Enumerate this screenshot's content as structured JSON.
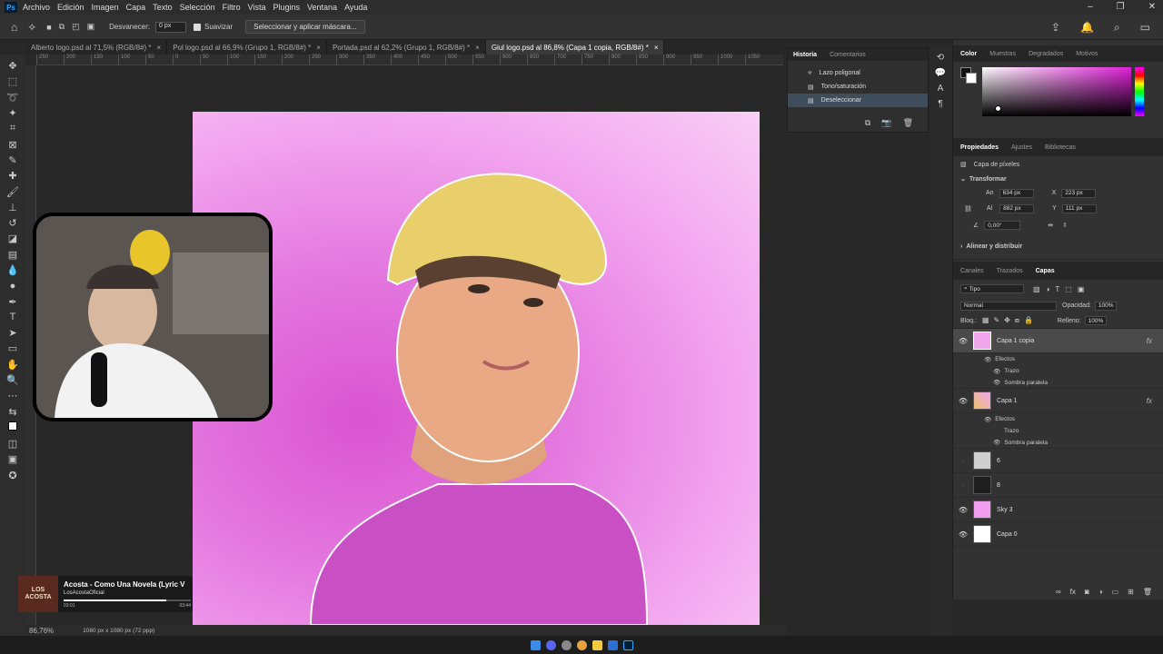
{
  "menu": {
    "items": [
      "Archivo",
      "Edición",
      "Imagen",
      "Capa",
      "Texto",
      "Selección",
      "Filtro",
      "Vista",
      "Plugins",
      "Ventana",
      "Ayuda"
    ]
  },
  "options": {
    "feather_label": "Desvanecer:",
    "feather_value": "0 px",
    "smooth_label": "Suavizar",
    "mask_button": "Seleccionar y aplicar máscara..."
  },
  "doc_tabs": [
    {
      "label": "Alberto logo.psd al 71,5% (RGB/8#) *",
      "active": false
    },
    {
      "label": "Pol logo.psd al 66,9% (Grupo 1, RGB/8#) *",
      "active": false
    },
    {
      "label": "Portada.psd al 62,2% (Grupo 1, RGB/8#) *",
      "active": false
    },
    {
      "label": "Giul logo.psd al 86,8% (Capa 1 copia, RGB/8#) *",
      "active": true
    }
  ],
  "ruler_ticks": [
    "250",
    "200",
    "150",
    "100",
    "50",
    "0",
    "50",
    "100",
    "150",
    "200",
    "250",
    "300",
    "350",
    "400",
    "450",
    "500",
    "550",
    "600",
    "650",
    "700",
    "750",
    "800",
    "850",
    "900",
    "950",
    "1000",
    "1050"
  ],
  "status": {
    "zoom": "86,76%",
    "doc_info": "1080 px x 1080 px (72 ppp)"
  },
  "history": {
    "tabs": [
      "Historia",
      "Comentarios"
    ],
    "items": [
      {
        "label": "Lazo poligonal",
        "selected": false
      },
      {
        "label": "Tono/saturación",
        "selected": false
      },
      {
        "label": "Deseleccionar",
        "selected": true
      }
    ]
  },
  "color_panel": {
    "tabs": [
      "Color",
      "Muestras",
      "Degradados",
      "Motivos"
    ],
    "hue_color": "#e020d8"
  },
  "properties": {
    "tabs": [
      "Propiedades",
      "Ajustes",
      "Bibliotecas"
    ],
    "layer_type": "Capa de píxeles",
    "transform_title": "Transformar",
    "width_label": "An",
    "width_value": "634 px",
    "x_label": "X",
    "x_value": "223 px",
    "height_label": "Al",
    "height_value": "882 px",
    "y_label": "Y",
    "y_value": "111 px",
    "angle_value": "0,00°",
    "align_title": "Alinear y distribuir"
  },
  "layers_panel": {
    "tabs": [
      "Canales",
      "Trazados",
      "Capas"
    ],
    "filter": "Tipo",
    "blend_mode": "Normal",
    "opacity_label": "Opacidad:",
    "opacity_value": "100%",
    "lock_label": "Bloq.:",
    "fill_label": "Relleno:",
    "fill_value": "100%",
    "layers": [
      {
        "name": "Capa 1 copia",
        "visible": true,
        "selected": true,
        "fx": "fx",
        "effects_title": "Efectos",
        "effects": [
          "Trazo",
          "Sombra paralela"
        ]
      },
      {
        "name": "Capa 1",
        "visible": true,
        "selected": false,
        "fx": "fx",
        "effects_title": "Efectos",
        "effects": [
          "Trazo",
          "Sombra paralela"
        ]
      },
      {
        "name": "6",
        "visible": false,
        "selected": false
      },
      {
        "name": "8",
        "visible": false,
        "selected": false
      },
      {
        "name": "Sky 3",
        "visible": true,
        "selected": false
      },
      {
        "name": "Capa 0",
        "visible": true,
        "selected": false
      }
    ]
  },
  "music": {
    "title": "Acosta - Como Una Novela (Lyric V",
    "channel": "LosAcostaOficial",
    "elapsed": "03:01",
    "duration": "03:44",
    "cover_text": "LOS ACOSTA",
    "progress": 0.81
  }
}
